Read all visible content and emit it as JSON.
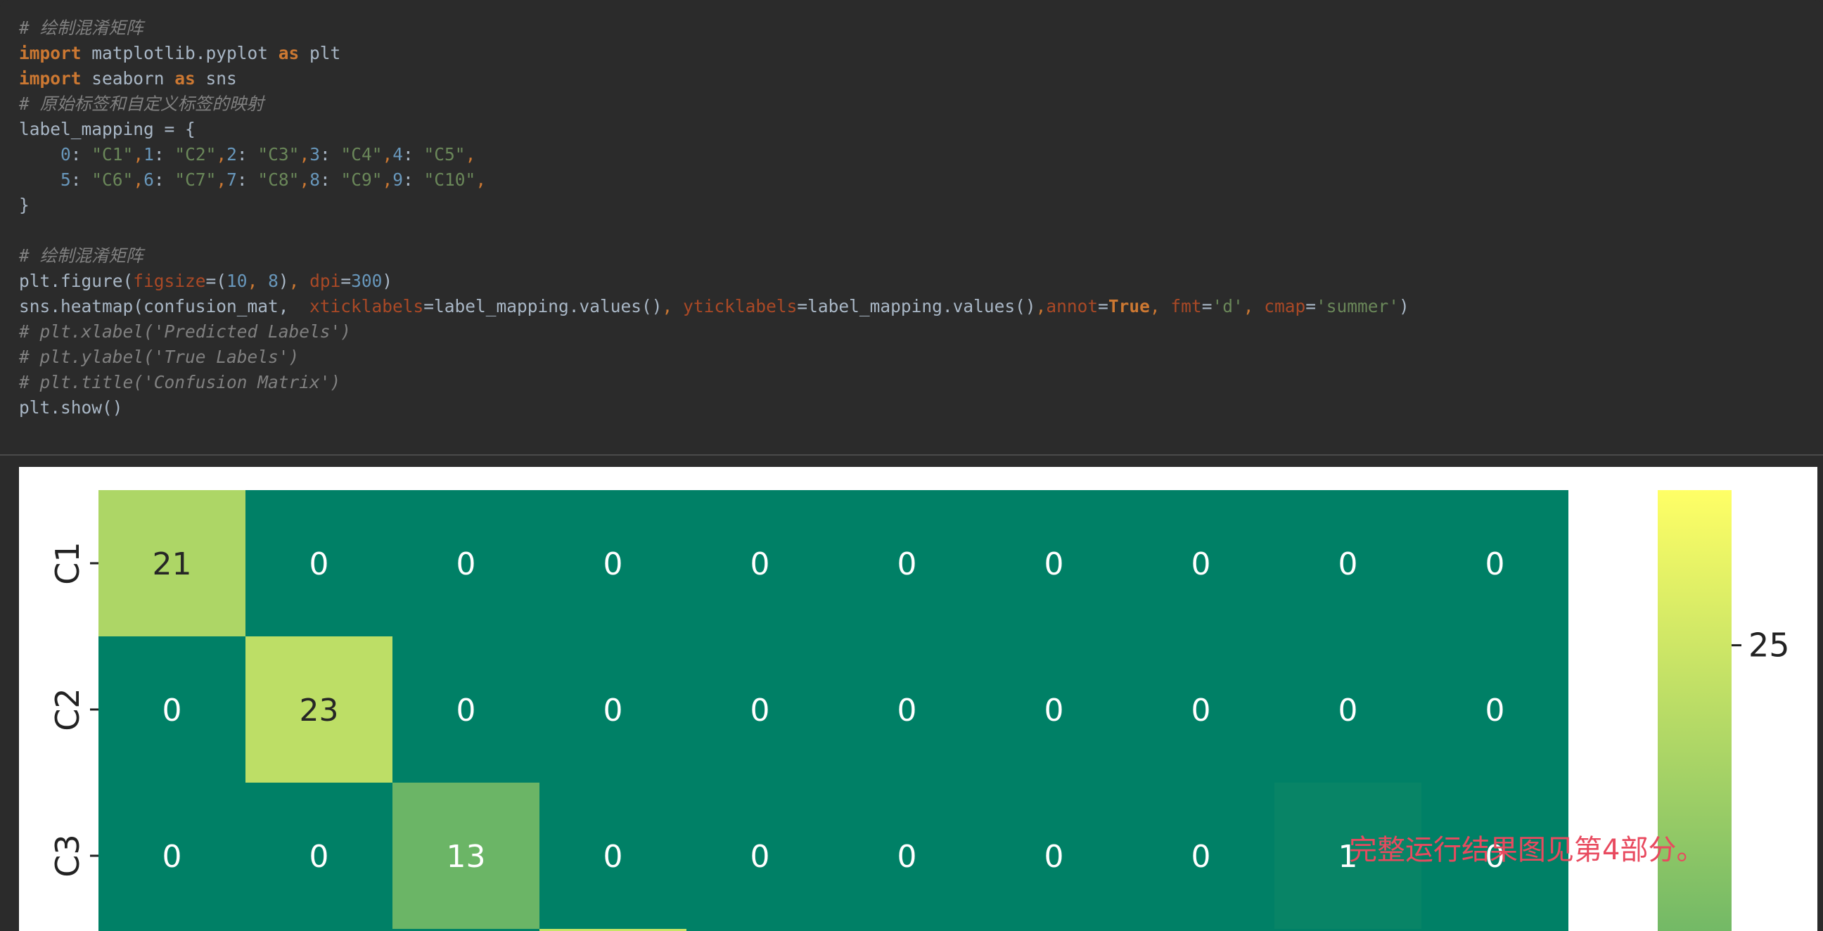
{
  "code": {
    "lines": [
      [
        {
          "t": "comment",
          "v": "# 绘制混淆矩阵"
        }
      ],
      [
        {
          "t": "keyword",
          "v": "import"
        },
        {
          "t": "plain",
          "v": " matplotlib.pyplot "
        },
        {
          "t": "keyword",
          "v": "as"
        },
        {
          "t": "plain",
          "v": " plt"
        }
      ],
      [
        {
          "t": "keyword",
          "v": "import"
        },
        {
          "t": "plain",
          "v": " seaborn "
        },
        {
          "t": "keyword",
          "v": "as"
        },
        {
          "t": "plain",
          "v": " sns"
        }
      ],
      [
        {
          "t": "comment",
          "v": "# 原始标签和自定义标签的映射"
        }
      ],
      [
        {
          "t": "plain",
          "v": "label_mapping = {"
        }
      ],
      [
        {
          "t": "plain",
          "v": "    "
        },
        {
          "t": "number",
          "v": "0"
        },
        {
          "t": "plain",
          "v": ": "
        },
        {
          "t": "string",
          "v": "\"C1\""
        },
        {
          "t": "punct",
          "v": ","
        },
        {
          "t": "number",
          "v": "1"
        },
        {
          "t": "plain",
          "v": ": "
        },
        {
          "t": "string",
          "v": "\"C2\""
        },
        {
          "t": "punct",
          "v": ","
        },
        {
          "t": "number",
          "v": "2"
        },
        {
          "t": "plain",
          "v": ": "
        },
        {
          "t": "string",
          "v": "\"C3\""
        },
        {
          "t": "punct",
          "v": ","
        },
        {
          "t": "number",
          "v": "3"
        },
        {
          "t": "plain",
          "v": ": "
        },
        {
          "t": "string",
          "v": "\"C4\""
        },
        {
          "t": "punct",
          "v": ","
        },
        {
          "t": "number",
          "v": "4"
        },
        {
          "t": "plain",
          "v": ": "
        },
        {
          "t": "string",
          "v": "\"C5\""
        },
        {
          "t": "punct",
          "v": ","
        }
      ],
      [
        {
          "t": "plain",
          "v": "    "
        },
        {
          "t": "number",
          "v": "5"
        },
        {
          "t": "plain",
          "v": ": "
        },
        {
          "t": "string",
          "v": "\"C6\""
        },
        {
          "t": "punct",
          "v": ","
        },
        {
          "t": "number",
          "v": "6"
        },
        {
          "t": "plain",
          "v": ": "
        },
        {
          "t": "string",
          "v": "\"C7\""
        },
        {
          "t": "punct",
          "v": ","
        },
        {
          "t": "number",
          "v": "7"
        },
        {
          "t": "plain",
          "v": ": "
        },
        {
          "t": "string",
          "v": "\"C8\""
        },
        {
          "t": "punct",
          "v": ","
        },
        {
          "t": "number",
          "v": "8"
        },
        {
          "t": "plain",
          "v": ": "
        },
        {
          "t": "string",
          "v": "\"C9\""
        },
        {
          "t": "punct",
          "v": ","
        },
        {
          "t": "number",
          "v": "9"
        },
        {
          "t": "plain",
          "v": ": "
        },
        {
          "t": "string",
          "v": "\"C10\""
        },
        {
          "t": "punct",
          "v": ","
        }
      ],
      [
        {
          "t": "plain",
          "v": "}"
        }
      ],
      [
        {
          "t": "plain",
          "v": ""
        }
      ],
      [
        {
          "t": "comment",
          "v": "# 绘制混淆矩阵"
        }
      ],
      [
        {
          "t": "plain",
          "v": "plt.figure("
        },
        {
          "t": "param",
          "v": "figsize"
        },
        {
          "t": "plain",
          "v": "=("
        },
        {
          "t": "number",
          "v": "10"
        },
        {
          "t": "punct",
          "v": ", "
        },
        {
          "t": "number",
          "v": "8"
        },
        {
          "t": "plain",
          "v": ")"
        },
        {
          "t": "punct",
          "v": ", "
        },
        {
          "t": "param",
          "v": "dpi"
        },
        {
          "t": "plain",
          "v": "="
        },
        {
          "t": "number",
          "v": "300"
        },
        {
          "t": "plain",
          "v": ")"
        }
      ],
      [
        {
          "t": "plain",
          "v": "sns.heatmap(confusion_mat,  "
        },
        {
          "t": "param",
          "v": "xticklabels"
        },
        {
          "t": "plain",
          "v": "=label_mapping.values()"
        },
        {
          "t": "punct",
          "v": ", "
        },
        {
          "t": "param",
          "v": "yticklabels"
        },
        {
          "t": "plain",
          "v": "=label_mapping.values()"
        },
        {
          "t": "punct",
          "v": ","
        },
        {
          "t": "param",
          "v": "annot"
        },
        {
          "t": "plain",
          "v": "="
        },
        {
          "t": "keyword",
          "v": "True"
        },
        {
          "t": "punct",
          "v": ", "
        },
        {
          "t": "param",
          "v": "fmt"
        },
        {
          "t": "plain",
          "v": "="
        },
        {
          "t": "string",
          "v": "'d'"
        },
        {
          "t": "punct",
          "v": ", "
        },
        {
          "t": "param",
          "v": "cmap"
        },
        {
          "t": "plain",
          "v": "="
        },
        {
          "t": "string",
          "v": "'summer'"
        },
        {
          "t": "plain",
          "v": ")"
        }
      ],
      [
        {
          "t": "comment",
          "v": "# plt.xlabel('Predicted Labels')"
        }
      ],
      [
        {
          "t": "comment",
          "v": "# plt.ylabel('True Labels')"
        }
      ],
      [
        {
          "t": "comment",
          "v": "# plt.title('Confusion Matrix')"
        }
      ],
      [
        {
          "t": "plain",
          "v": "plt.show()"
        }
      ]
    ]
  },
  "chart_data": {
    "type": "heatmap",
    "colormap": "summer",
    "row_labels": [
      "C1",
      "C2",
      "C3"
    ],
    "columns": 10,
    "visible_partial_row": 3,
    "matrix": [
      [
        21,
        0,
        0,
        0,
        0,
        0,
        0,
        0,
        0,
        0
      ],
      [
        0,
        23,
        0,
        0,
        0,
        0,
        0,
        0,
        0,
        0
      ],
      [
        0,
        0,
        13,
        0,
        0,
        0,
        0,
        0,
        1,
        0
      ]
    ],
    "value_range": [
      0,
      31
    ],
    "colorbar": {
      "ticks": [
        25
      ],
      "tick_labels": [
        "25"
      ]
    }
  },
  "watermark": {
    "text": "完整运行结果图见第4部分。",
    "color": "#e84a5f"
  }
}
